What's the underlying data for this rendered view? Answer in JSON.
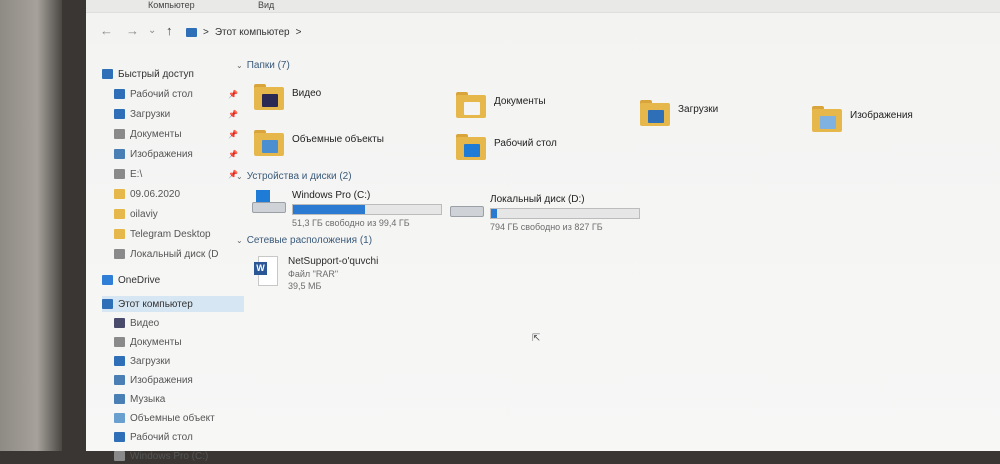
{
  "ribbon": {
    "tabs": [
      "Компьютер",
      "Вид"
    ]
  },
  "address": {
    "breadcrumb_root": "Этот компьютер",
    "separator": ">"
  },
  "nav": {
    "back": "←",
    "forward": "→",
    "dropdown": "⌄",
    "up": "↑"
  },
  "sidebar": {
    "quick_access": "Быстрый доступ",
    "pinned": [
      {
        "label": "Рабочий стол",
        "icon": "desktop-icon",
        "color": "#2f6fb8"
      },
      {
        "label": "Загрузки",
        "icon": "downloads-icon",
        "color": "#2f6fb8"
      },
      {
        "label": "Документы",
        "icon": "documents-icon",
        "color": "#8a8a8a"
      },
      {
        "label": "Изображения",
        "icon": "pictures-icon",
        "color": "#4a7fb5"
      },
      {
        "label": "E:\\",
        "icon": "drive-icon",
        "color": "#8a8a8a"
      }
    ],
    "recent": [
      {
        "label": "09.06.2020",
        "icon": "folder-icon",
        "color": "#e6b84c"
      },
      {
        "label": "oilaviy",
        "icon": "folder-icon",
        "color": "#e6b84c"
      },
      {
        "label": "Telegram Desktop",
        "icon": "folder-icon",
        "color": "#e6b84c"
      },
      {
        "label": "Локальный диск (D",
        "icon": "drive-icon",
        "color": "#8a8a8a"
      }
    ],
    "onedrive": "OneDrive",
    "this_pc": "Этот компьютер",
    "pc_children": [
      {
        "label": "Видео",
        "icon": "video-icon",
        "color": "#4a4a6a"
      },
      {
        "label": "Документы",
        "icon": "documents-icon",
        "color": "#8a8a8a"
      },
      {
        "label": "Загрузки",
        "icon": "downloads-icon",
        "color": "#2f6fb8"
      },
      {
        "label": "Изображения",
        "icon": "pictures-icon",
        "color": "#4a7fb5"
      },
      {
        "label": "Музыка",
        "icon": "music-icon",
        "color": "#4a7fb5"
      },
      {
        "label": "Объемные объект",
        "icon": "3d-objects-icon",
        "color": "#6aa0d0"
      },
      {
        "label": "Рабочий стол",
        "icon": "desktop-icon",
        "color": "#2f6fb8"
      },
      {
        "label": "Windows Pro (C:)",
        "icon": "drive-icon",
        "color": "#8a8a8a"
      }
    ]
  },
  "groups": {
    "folders": "Папки (7)",
    "devices": "Устройства и диски (2)",
    "network": "Сетевые расположения (1)"
  },
  "folders": [
    {
      "label": "Видео",
      "icon": "video-folder-icon",
      "emb": "#2a2a55"
    },
    {
      "label": "Документы",
      "icon": "documents-folder-icon",
      "emb": "#f4f4f4"
    },
    {
      "label": "Загрузки",
      "icon": "downloads-folder-icon",
      "emb": "#2f6fb8"
    },
    {
      "label": "Изображения",
      "icon": "pictures-folder-icon",
      "emb": "#7fb2e0"
    },
    {
      "label": "Объемные объекты",
      "icon": "3d-objects-folder-icon",
      "emb": "#4b8fd0"
    },
    {
      "label": "Рабочий стол",
      "icon": "desktop-folder-icon",
      "emb": "#1e7bd6"
    }
  ],
  "drives": [
    {
      "name": "Windows Pro  (C:)",
      "free": "51,3 ГБ свободно из 99,4 ГБ",
      "used_fraction": 0.484,
      "icon": "windows-drive-icon"
    },
    {
      "name": "Локальный диск (D:)",
      "free": "794 ГБ свободно из 827 ГБ",
      "used_fraction": 0.04,
      "icon": "local-drive-icon"
    }
  ],
  "network_item": {
    "name": "NetSupport-o'quvchi",
    "type": "Файл \"RAR\"",
    "size": "39,5 МБ",
    "icon": "word-document-icon"
  },
  "colors": {
    "accent": "#2a7ad1",
    "folder": "#e6b84c",
    "selection": "#d6e6f3"
  }
}
